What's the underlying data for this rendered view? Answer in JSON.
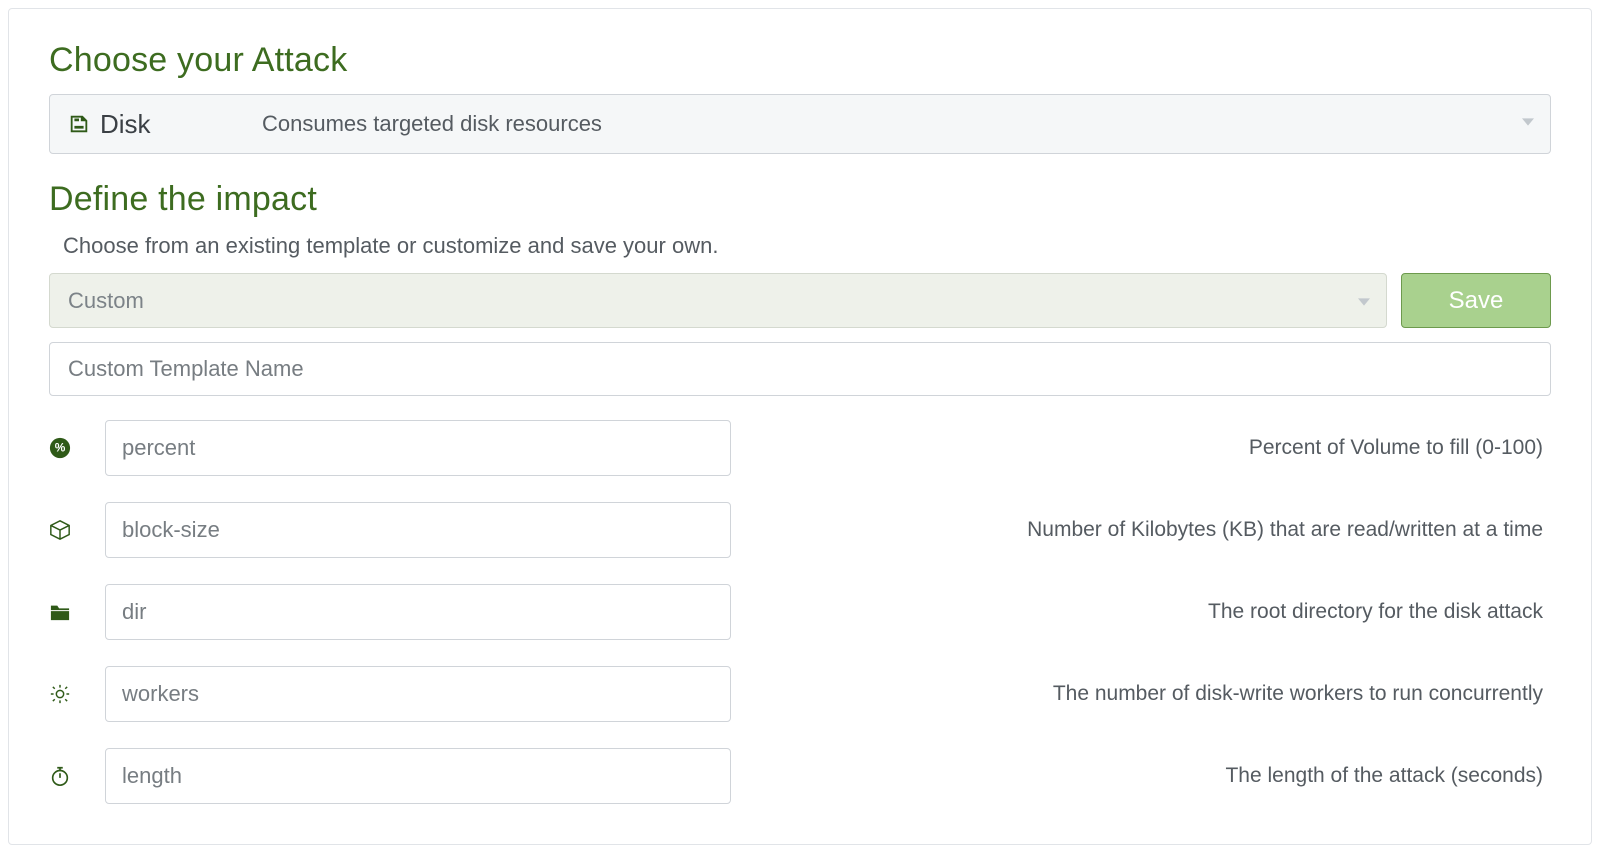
{
  "choose_attack": {
    "heading": "Choose your Attack",
    "selected_label": "Disk",
    "selected_desc": "Consumes targeted disk resources"
  },
  "impact": {
    "heading": "Define the impact",
    "subtitle": "Choose from an existing template or customize and save your own.",
    "template_selected": "Custom",
    "save_label": "Save",
    "name_placeholder": "Custom Template Name"
  },
  "params": [
    {
      "icon": "percent-icon",
      "placeholder": "percent",
      "help": "Percent of Volume to fill (0-100)"
    },
    {
      "icon": "cube-icon",
      "placeholder": "block-size",
      "help": "Number of Kilobytes (KB) that are read/written at a time"
    },
    {
      "icon": "folder-icon",
      "placeholder": "dir",
      "help": "The root directory for the disk attack"
    },
    {
      "icon": "gear-icon",
      "placeholder": "workers",
      "help": "The number of disk-write workers to run concurrently"
    },
    {
      "icon": "stopwatch-icon",
      "placeholder": "length",
      "help": "The length of the attack (seconds)"
    }
  ]
}
